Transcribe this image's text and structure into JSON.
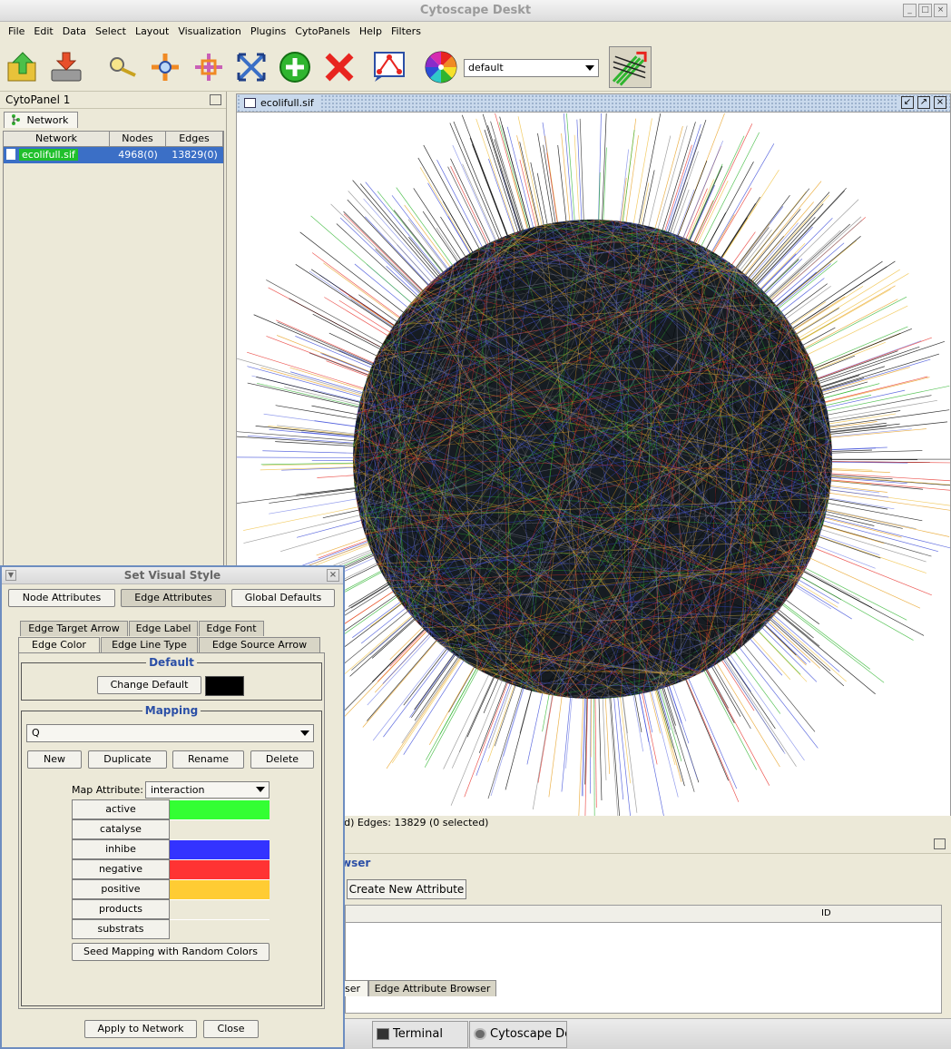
{
  "window": {
    "title": "Cytoscape Deskt",
    "controls": [
      "_",
      "□",
      "×"
    ]
  },
  "menubar": [
    "File",
    "Edit",
    "Data",
    "Select",
    "Layout",
    "Visualization",
    "Plugins",
    "CytoPanels",
    "Help",
    "Filters"
  ],
  "toolbar": {
    "icons": [
      "open-session-icon",
      "save-session-icon",
      "zoom-icon",
      "zoom-in-icon",
      "zoom-out-icon",
      "zoom-fit-icon",
      "add-node-icon",
      "delete-icon",
      "vizmapper-icon",
      "color-wheel-icon",
      "edge-bundle-icon"
    ],
    "style_selected": "default"
  },
  "cytopanel": {
    "title": "CytoPanel 1",
    "tab_label": "Network",
    "columns": [
      "Network",
      "Nodes",
      "Edges"
    ],
    "rows": [
      {
        "name": "ecolifull.sif",
        "nodes": "4968(0)",
        "edges": "13829(0)"
      }
    ]
  },
  "network_view": {
    "title": "ecolifull.sif",
    "status": "ted) Edges: 13829 (0 selected)"
  },
  "attribute_browser": {
    "legend": "wser",
    "create_button": "Create New Attribute",
    "column_header": "ID",
    "tabs": [
      "ser",
      "Edge Attribute Browser"
    ]
  },
  "taskbar": {
    "items": [
      {
        "label": "Terminal",
        "icon": "terminal-icon"
      },
      {
        "label": "Cytoscape De",
        "icon": "cytoscape-icon"
      }
    ]
  },
  "vizstyle_dialog": {
    "title": "Set Visual Style",
    "top_buttons": [
      "Node Attributes",
      "Edge Attributes",
      "Global Defaults"
    ],
    "tabs_row1": [
      "Edge Target Arrow",
      "Edge Label",
      "Edge Font"
    ],
    "tabs_row2": [
      "Edge Color",
      "Edge Line Type",
      "Edge Source Arrow"
    ],
    "default_group": {
      "title": "Default",
      "change_button": "Change Default",
      "color": "#000000"
    },
    "mapping_group": {
      "title": "Mapping",
      "selected": "Q",
      "buttons": [
        "New",
        "Duplicate",
        "Rename",
        "Delete"
      ],
      "map_attribute_label": "Map Attribute:",
      "map_attribute_value": "interaction",
      "entries": [
        {
          "key": "active",
          "color": "#33ff33"
        },
        {
          "key": "catalyse",
          "color": "#ece9d8"
        },
        {
          "key": "inhibe",
          "color": "#3333ff"
        },
        {
          "key": "negative",
          "color": "#ff3333"
        },
        {
          "key": "positive",
          "color": "#ffcc33"
        },
        {
          "key": "products",
          "color": "#ece9d8"
        },
        {
          "key": "substrats",
          "color": "#ece9d8"
        }
      ],
      "seed_button": "Seed Mapping with Random Colors"
    },
    "apply_button": "Apply to Network",
    "close_button": "Close"
  }
}
